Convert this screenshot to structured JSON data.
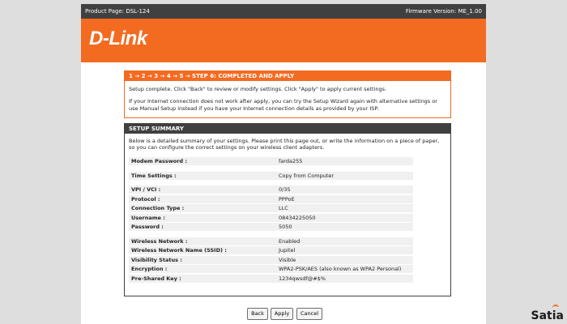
{
  "topbar": {
    "product": "Product Page: DSL-124",
    "firmware": "Firmware Version: ME_1.00"
  },
  "brand": {
    "logo": "D-Link"
  },
  "step": {
    "header": "1 → 2 → 3 → 4 → 5 → STEP 6: COMPLETED AND APPLY",
    "para1": "Setup complete. Click \"Back\" to review or modify settings. Click \"Apply\" to apply current settings.",
    "para2": "If your Internet connection does not work after apply, you can try the Setup Wizard again with alternative settings or use Manual Setup instead if you have your Internet connection details as provided by your ISP."
  },
  "summary": {
    "header": "SETUP SUMMARY",
    "intro": "Below is a detailed summary of your settings. Please print this page out, or write the information on a piece of paper, so you can configure the correct settings on your wireless client adapters.",
    "groups": [
      [
        {
          "label": "Modem Password :",
          "value": "farda255"
        }
      ],
      [
        {
          "label": "Time Settings :",
          "value": "Copy from Computer"
        }
      ],
      [
        {
          "label": "VPI / VCI :",
          "value": "0/35"
        },
        {
          "label": "Protocol :",
          "value": "PPPoE"
        },
        {
          "label": "Connection Type :",
          "value": "LLC"
        },
        {
          "label": "Username :",
          "value": "08434225050"
        },
        {
          "label": "Password :",
          "value": "5050"
        }
      ],
      [
        {
          "label": "Wireless Network :",
          "value": "Enabled"
        },
        {
          "label": "Wireless Network Name (SSID) :",
          "value": "Jupitel"
        },
        {
          "label": "Visibility Status :",
          "value": "Visible"
        },
        {
          "label": "Encryption :",
          "value": "WPA2-PSK/AES (also known as WPA2 Personal)"
        },
        {
          "label": "Pre-Shared Key :",
          "value": "1234qwsdf@#$%"
        }
      ]
    ]
  },
  "buttons": {
    "back": "Back",
    "apply": "Apply",
    "cancel": "Cancel"
  },
  "watermark": "Satia",
  "colors": {
    "accent": "#f36b21",
    "dark": "#404040",
    "row": "#f0f0f0"
  }
}
